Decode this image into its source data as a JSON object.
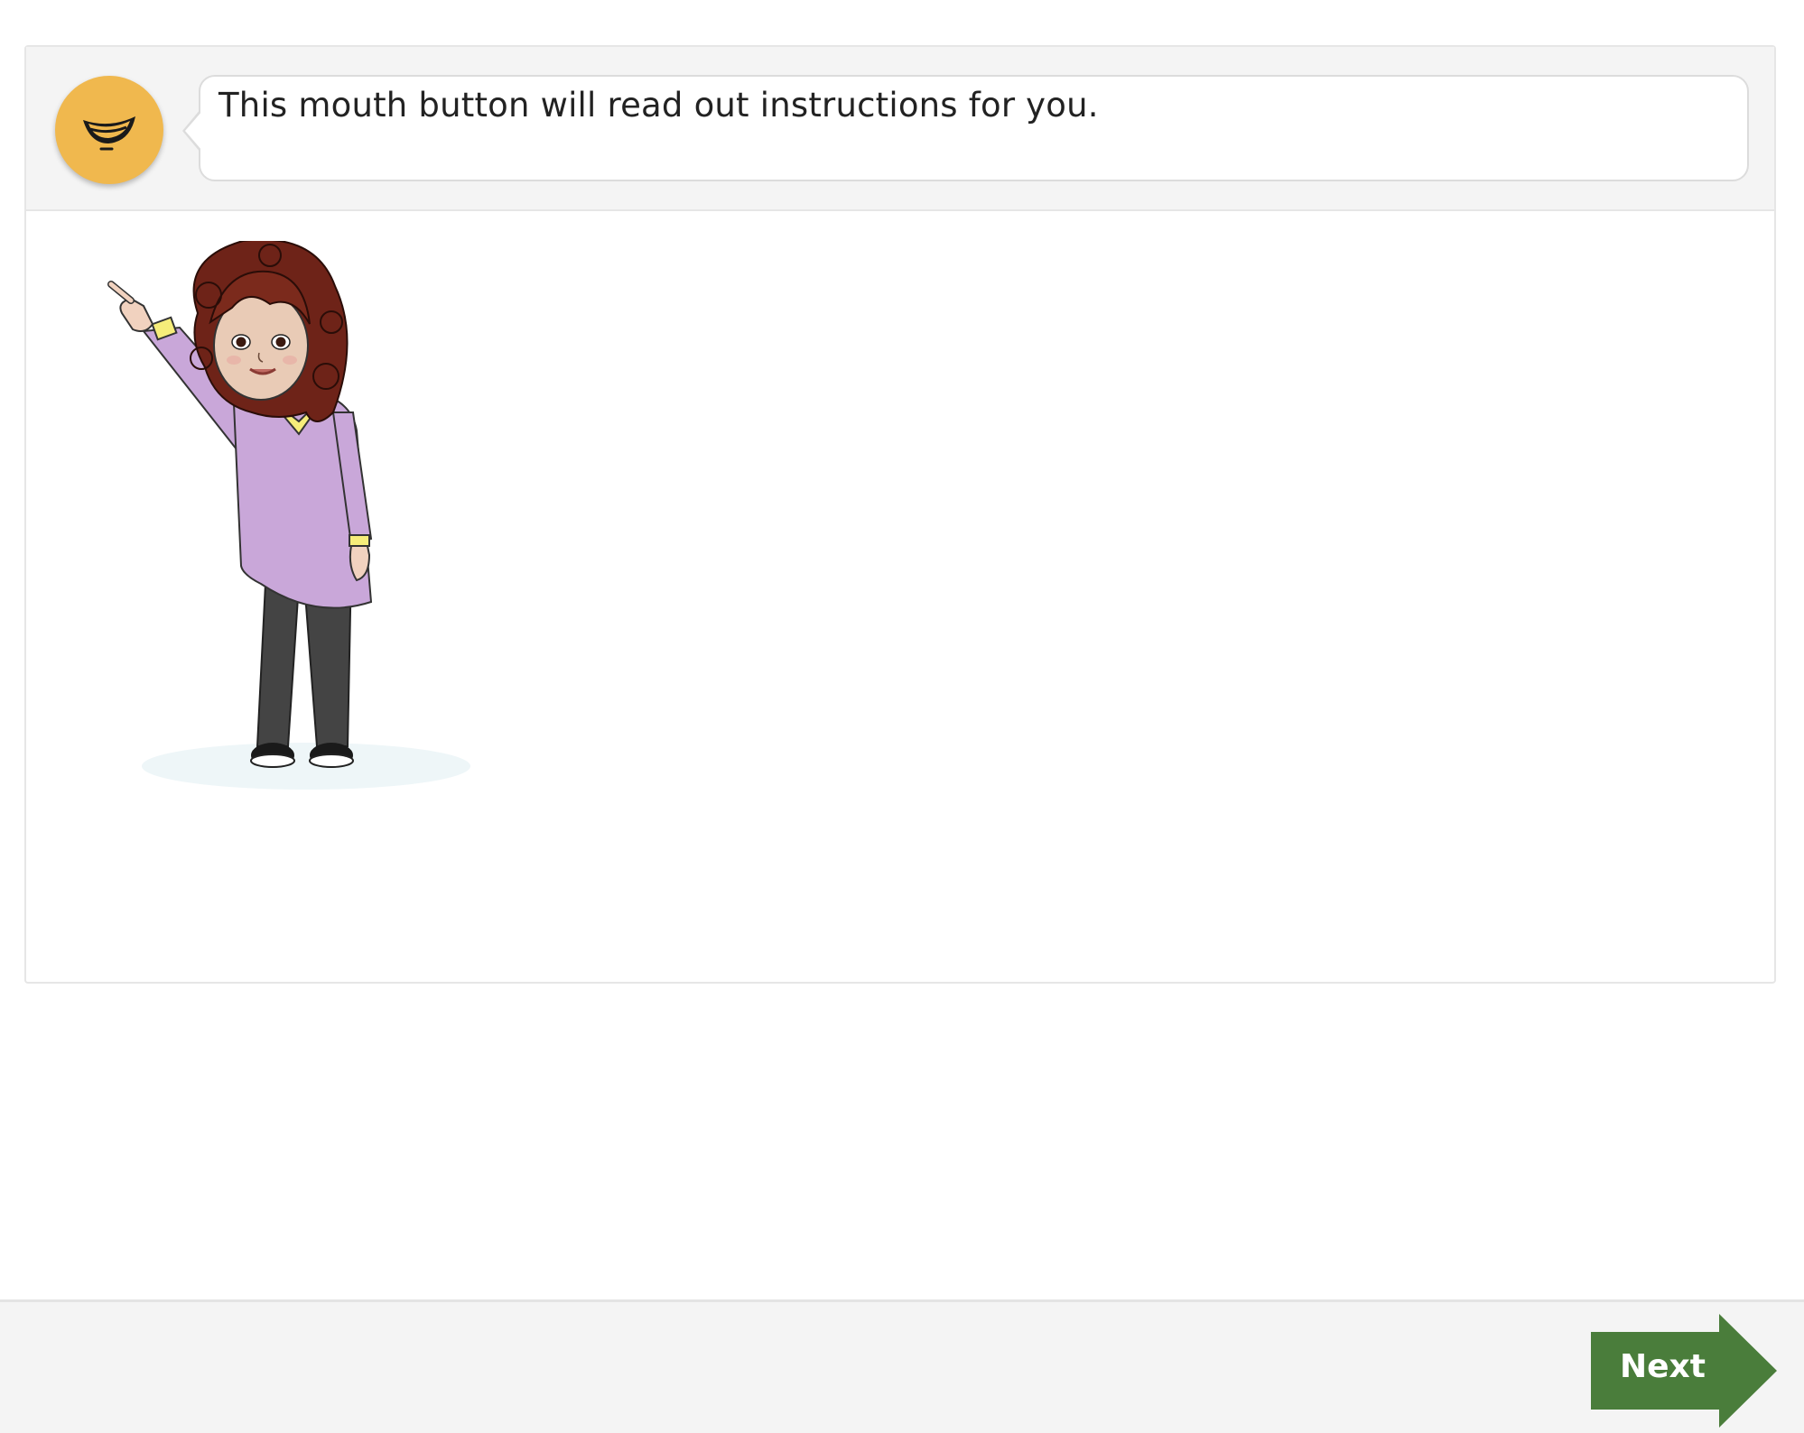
{
  "instruction": {
    "text": "This mouth button will read out instructions for you.",
    "speak_icon": "mouth-icon"
  },
  "navigation": {
    "next_label": "Next"
  },
  "colors": {
    "speak_button": "#f0b84e",
    "next_button": "#4a7d3b",
    "header_bg": "#f4f4f4"
  }
}
